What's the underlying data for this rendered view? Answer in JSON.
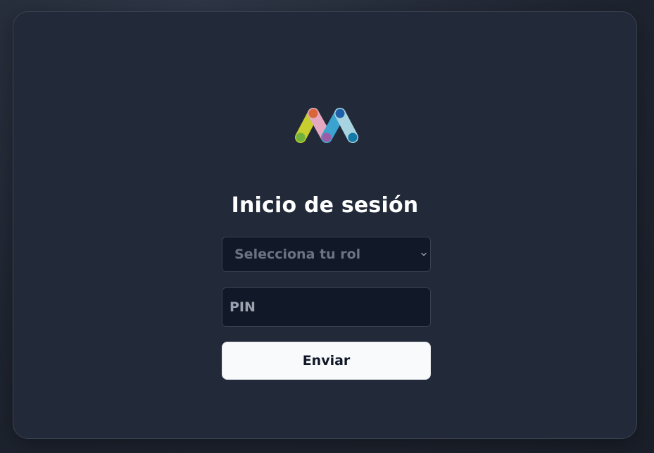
{
  "login": {
    "logo_icon": "multicolor-m-logo-icon",
    "title": "Inicio de sesión",
    "role_select": {
      "placeholder": "Selecciona tu rol",
      "icon": "chevron-down-icon"
    },
    "pin": {
      "value": "",
      "placeholder": "PIN"
    },
    "submit_label": "Enviar"
  },
  "colors": {
    "background": "#1f2531",
    "card": "#222a39",
    "input_bg": "#111827",
    "button_bg": "#f8fafc",
    "logo_yellow": "#c7ce2e",
    "logo_pink": "#e4a9c1",
    "logo_blue": "#3ba3cf",
    "logo_lightblue": "#a7d4e0"
  }
}
